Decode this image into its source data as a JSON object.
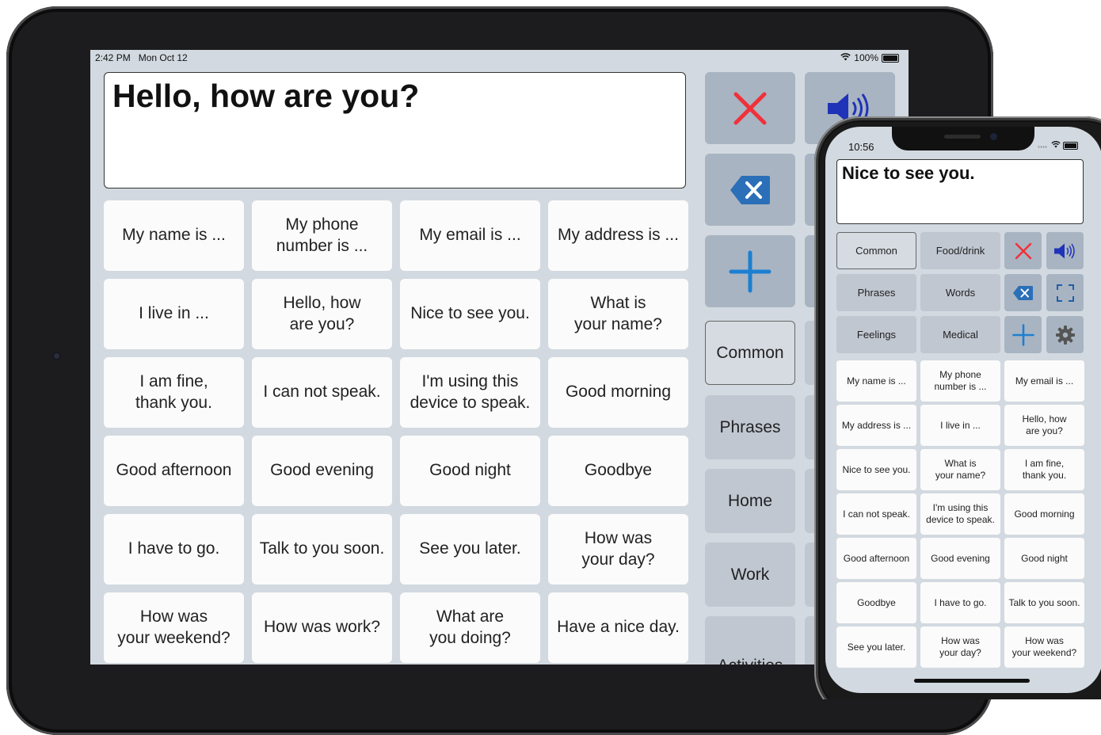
{
  "ipad": {
    "status": {
      "time": "2:42 PM   Mon Oct 12",
      "battery": "100%"
    },
    "message": "Hello, how are you?",
    "phrases": [
      "My name is ...",
      "My phone\nnumber is ...",
      "My email is ...",
      "My address is ...",
      "I live in ...",
      "Hello, how\nare you?",
      "Nice to see you.",
      "What is\nyour name?",
      "I am fine,\nthank you.",
      "I can not speak.",
      "I'm using this\ndevice to speak.",
      "Good morning",
      "Good afternoon",
      "Good evening",
      "Good night",
      "Goodbye",
      "I have to go.",
      "Talk to you soon.",
      "See you later.",
      "How was\nyour day?",
      "How was\nyour weekend?",
      "How was work?",
      "What are\nyou doing?",
      "Have a nice day."
    ],
    "categories": [
      "Common",
      "Phrases",
      "Home",
      "Work",
      "Activities"
    ],
    "controls": [
      "clear-icon",
      "speak-icon",
      "backspace-icon",
      "add-icon"
    ]
  },
  "iphone": {
    "status": {
      "time": "10:56"
    },
    "message": "Nice to see you.",
    "categories": [
      "Common",
      "Food/drink",
      "Phrases",
      "Words",
      "Feelings",
      "Medical"
    ],
    "controls": [
      "clear-icon",
      "speak-icon",
      "backspace-icon",
      "fullscreen-icon",
      "add-icon",
      "settings-icon"
    ],
    "phrases": [
      "My name is ...",
      "My phone\nnumber is ...",
      "My email is ...",
      "My address is ...",
      "I live in ...",
      "Hello, how\nare you?",
      "Nice to see you.",
      "What is\nyour name?",
      "I am fine,\nthank you.",
      "I can not speak.",
      "I'm using this\ndevice to speak.",
      "Good morning",
      "Good afternoon",
      "Good evening",
      "Good night",
      "Goodbye",
      "I have to go.",
      "Talk to you soon.",
      "See you later.",
      "How was\nyour day?",
      "How was\nyour weekend?"
    ]
  },
  "colors": {
    "clear": "#f0313a",
    "speak": "#1f33b8",
    "backspace": "#2a6fb8",
    "add": "#1d7fd1",
    "settings": "#555555"
  }
}
